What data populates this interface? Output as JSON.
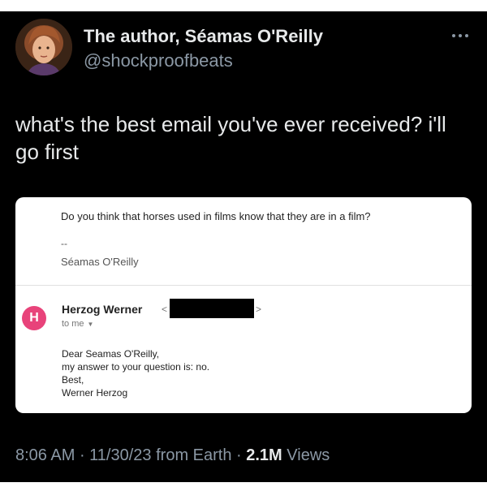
{
  "author": {
    "name": "The author, Séamas O'Reilly",
    "handle": "@shockproofbeats"
  },
  "tweet": {
    "text_line1": "what's the best email you've ever received? i'll",
    "text_line2": "go first"
  },
  "email": {
    "original_question": "Do you think that horses used in films know that they are in a film?",
    "signature_dash": "--",
    "signature_name": "Séamas O'Reilly",
    "sender_initial": "H",
    "sender_avatar_color": "#e8437a",
    "sender_name": "Herzog Werner",
    "email_open": "<",
    "email_close": ">",
    "recipient": "to me",
    "body_lines": [
      "Dear Seamas O'Reilly,",
      "my answer to your question is: no.",
      "Best,",
      "Werner Herzog"
    ]
  },
  "meta": {
    "time": "8:06 AM",
    "date": "11/30/23",
    "source": "from Earth",
    "views_count": "2.1M",
    "views_label": "Views"
  },
  "icons": {
    "more": "more-horizontal-icon",
    "caret": "chevron-down-icon"
  }
}
